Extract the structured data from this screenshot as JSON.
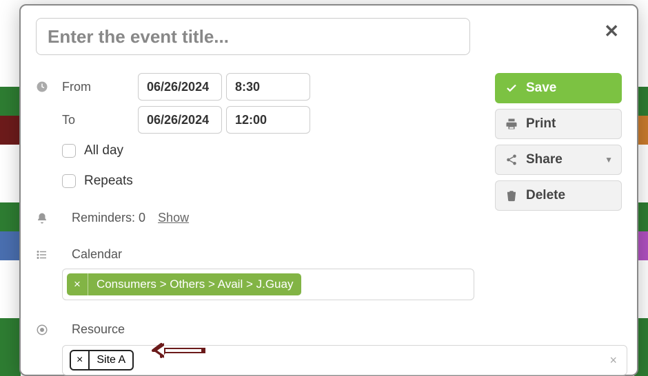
{
  "title_placeholder": "Enter the event title...",
  "from_label": "From",
  "to_label": "To",
  "from_date": "06/26/2024",
  "from_time": "8:30",
  "to_date": "06/26/2024",
  "to_time": "12:00",
  "all_day_label": "All day",
  "repeats_label": "Repeats",
  "reminders_label": "Reminders: 0",
  "show_label": "Show",
  "calendar_label": "Calendar",
  "calendar_tag": "Consumers > Others > Avail > J.Guay",
  "resource_label": "Resource",
  "resource_tag": "Site A",
  "buttons": {
    "save": "Save",
    "print": "Print",
    "share": "Share",
    "delete": "Delete"
  },
  "colors": {
    "accent_green": "#7cc242",
    "tag_green": "#82b445",
    "arrow": "#6b1a1a"
  }
}
